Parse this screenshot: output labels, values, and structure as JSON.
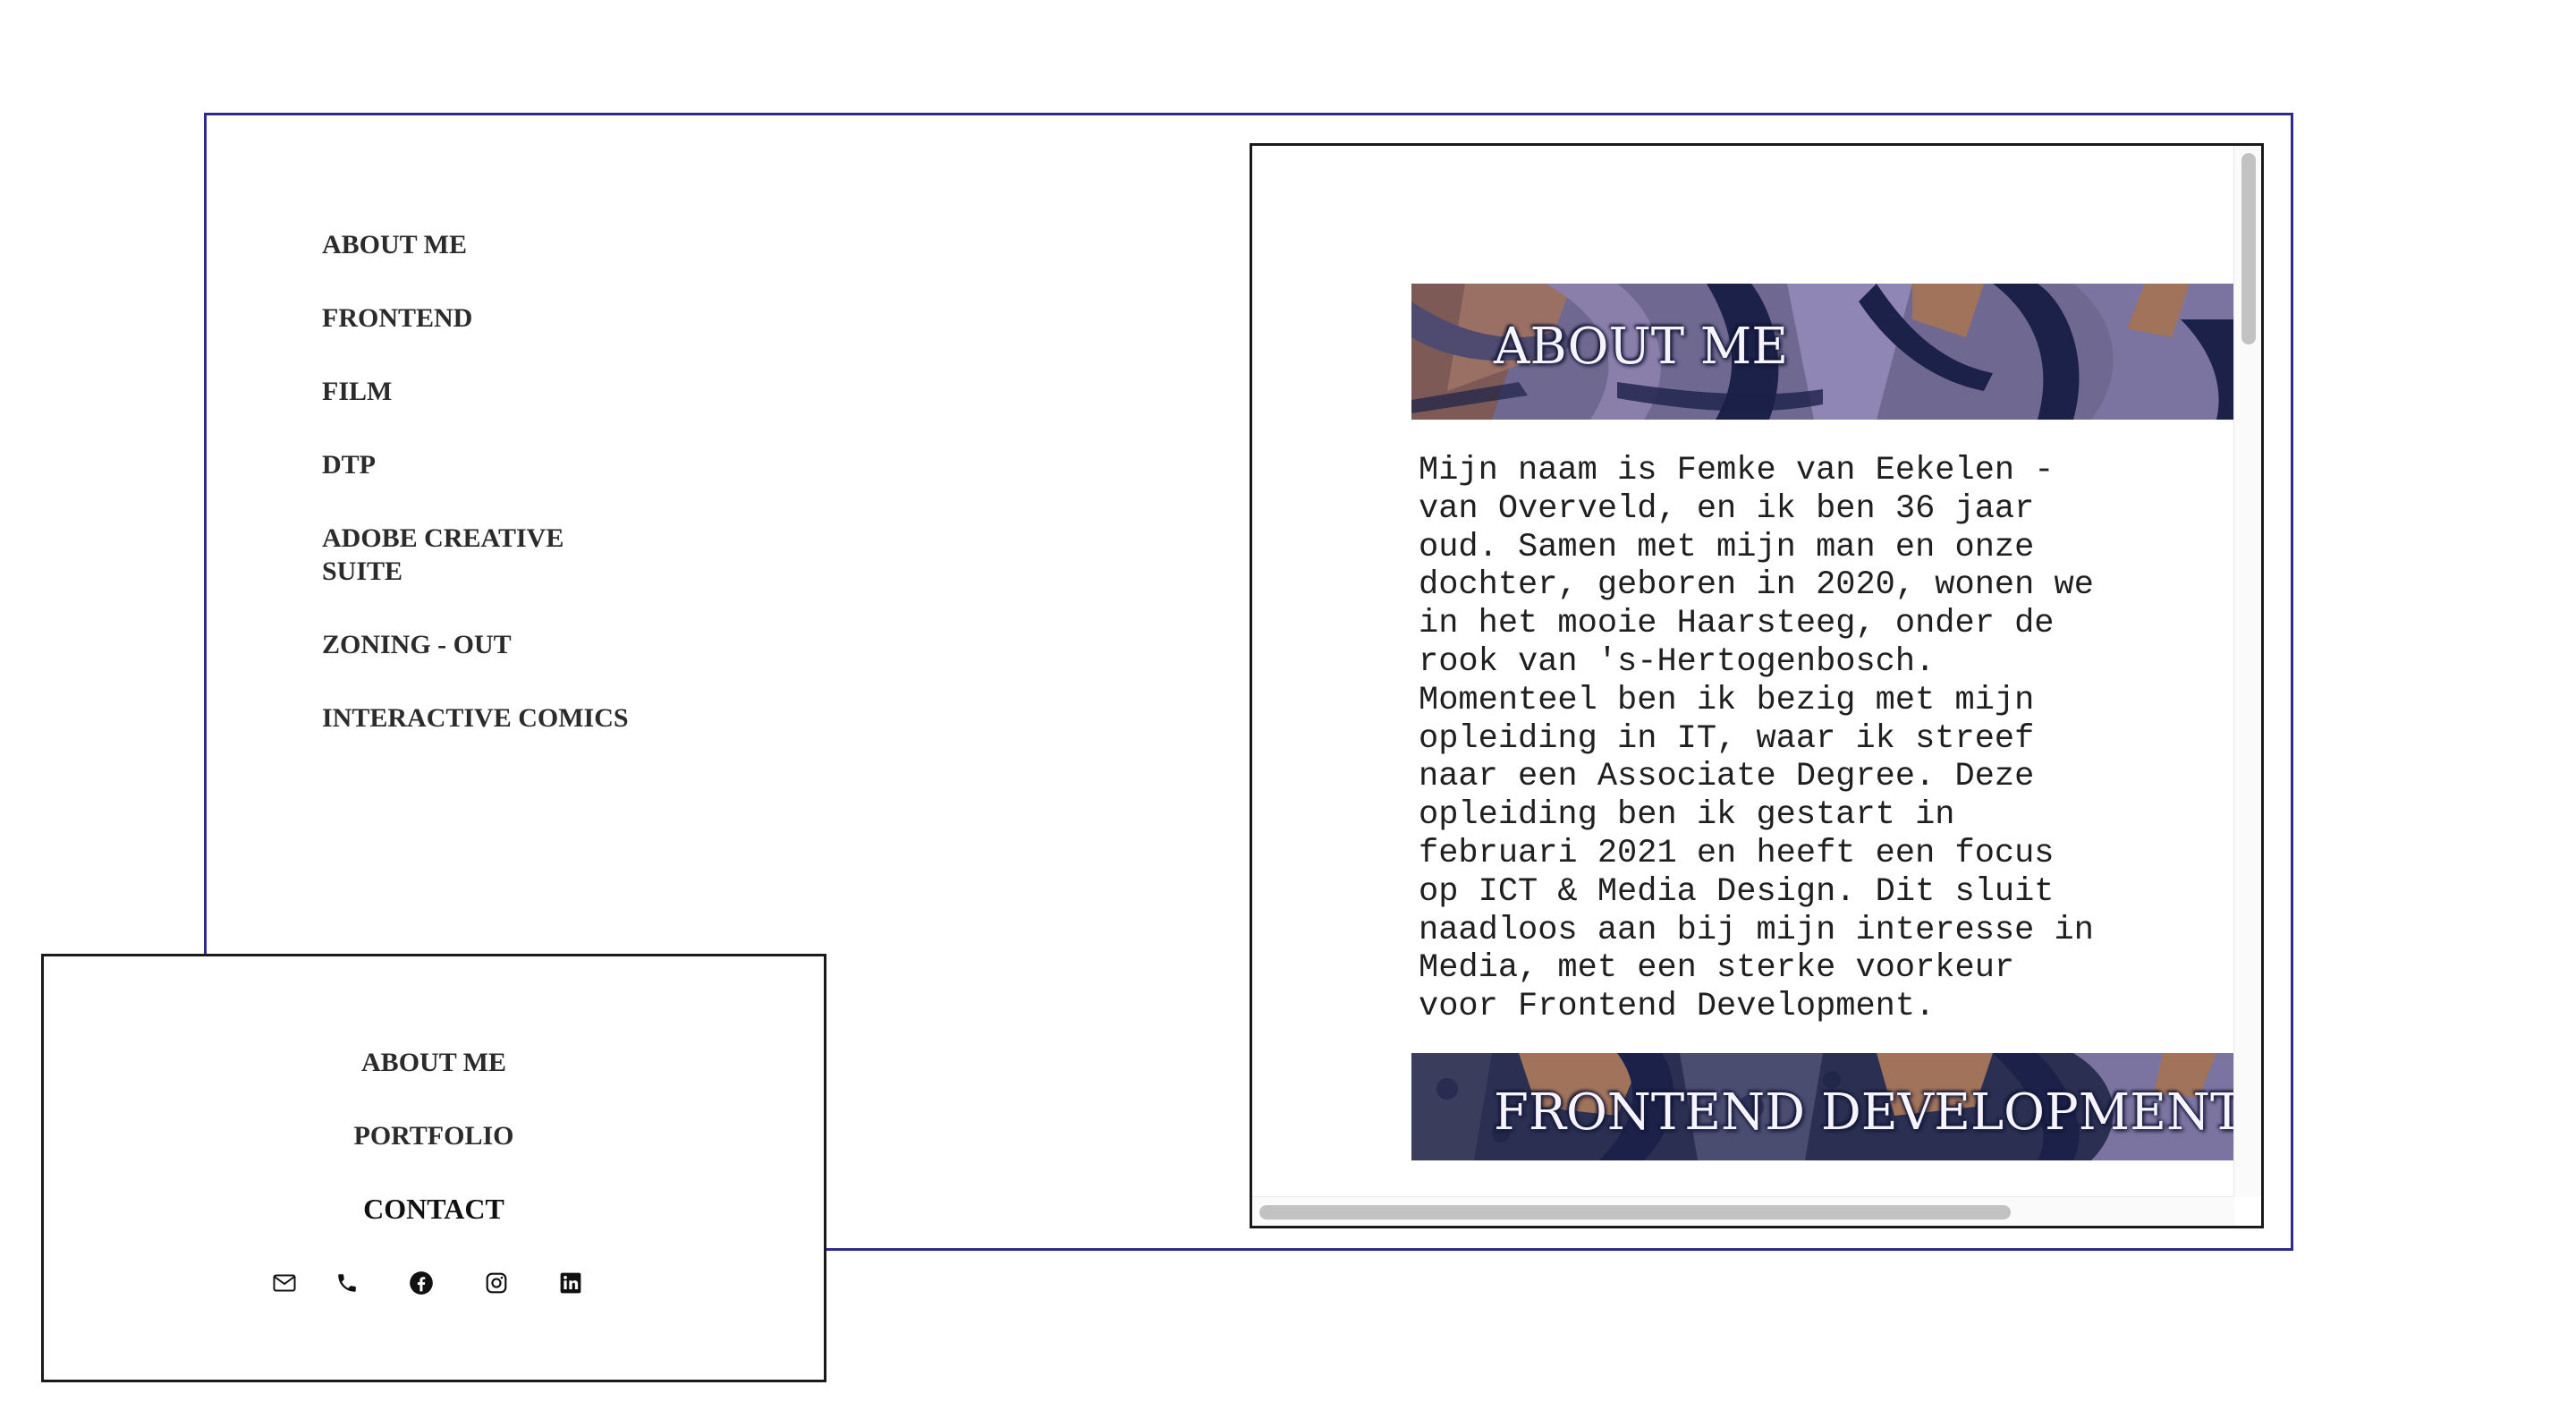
{
  "side_nav": {
    "items": [
      {
        "label": "ABOUT ME"
      },
      {
        "label": "FRONTEND"
      },
      {
        "label": "FILM"
      },
      {
        "label": "DTP"
      },
      {
        "label": "ADOBE CREATIVE SUITE"
      },
      {
        "label": "ZONING - OUT"
      },
      {
        "label": "INTERACTIVE COMICS"
      }
    ]
  },
  "content": {
    "about_title": "ABOUT ME",
    "about_text": "Mijn naam is Femke van Eekelen - van Overveld, en ik ben 36 jaar oud. Samen met mijn man en onze dochter, geboren in 2020, wonen we in het mooie Haarsteeg, onder de rook van 's-Hertogenbosch. Momenteel ben ik bezig met mijn opleiding in IT, waar ik streef naar een Associate Degree. Deze opleiding ben ik gestart in februari 2021 en heeft een focus op ICT & Media Design. Dit sluit naadloos aan bij mijn interesse in Media, met een sterke voorkeur voor Frontend Development.",
    "frontend_title": "FRONTEND DEVELOPMENT"
  },
  "float_menu": {
    "about_label": "ABOUT ME",
    "portfolio_label": "PORTFOLIO",
    "contact_label": "CONTACT",
    "social_icons": [
      "mail-icon",
      "phone-icon",
      "facebook-icon",
      "instagram-icon",
      "linkedin-icon"
    ]
  },
  "colors": {
    "frame_border": "#2e2a8e",
    "banner_base": "#6f6890",
    "banner_dark": "#1b2148",
    "banner_accent": "#a0735a"
  }
}
